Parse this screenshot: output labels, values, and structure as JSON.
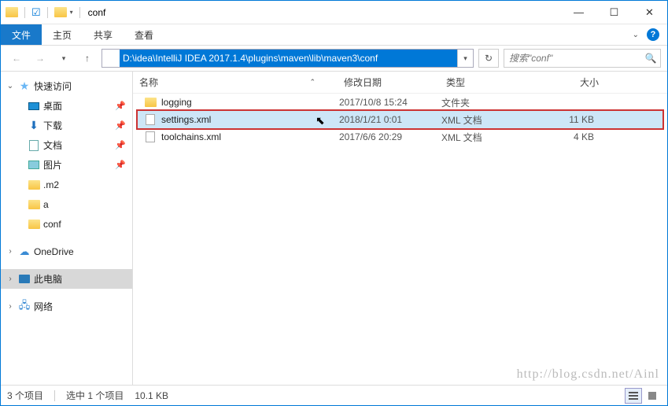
{
  "window": {
    "title": "conf"
  },
  "ribbon": {
    "file": "文件",
    "tabs": [
      "主页",
      "共享",
      "查看"
    ]
  },
  "address": {
    "path": "D:\\idea\\IntelliJ IDEA 2017.1.4\\plugins\\maven\\lib\\maven3\\conf",
    "search_placeholder": "搜索\"conf\""
  },
  "sidebar": {
    "quick_access": "快速访问",
    "items": [
      {
        "label": "桌面",
        "pin": true
      },
      {
        "label": "下载",
        "pin": true
      },
      {
        "label": "文档",
        "pin": true
      },
      {
        "label": "图片",
        "pin": true
      },
      {
        "label": ".m2",
        "pin": false
      },
      {
        "label": "a",
        "pin": false
      },
      {
        "label": "conf",
        "pin": false
      }
    ],
    "onedrive": "OneDrive",
    "this_pc": "此电脑",
    "network": "网络"
  },
  "columns": {
    "name": "名称",
    "date": "修改日期",
    "type": "类型",
    "size": "大小"
  },
  "files": [
    {
      "name": "logging",
      "date": "2017/10/8 15:24",
      "type": "文件夹",
      "size": "",
      "icon": "folder"
    },
    {
      "name": "settings.xml",
      "date": "2018/1/21 0:01",
      "type": "XML 文档",
      "size": "11 KB",
      "icon": "file",
      "selected": true
    },
    {
      "name": "toolchains.xml",
      "date": "2017/6/6 20:29",
      "type": "XML 文档",
      "size": "4 KB",
      "icon": "file"
    }
  ],
  "status": {
    "count": "3 个项目",
    "selected": "选中 1 个项目",
    "size": "10.1 KB"
  },
  "watermark": "http://blog.csdn.net/Ainl"
}
